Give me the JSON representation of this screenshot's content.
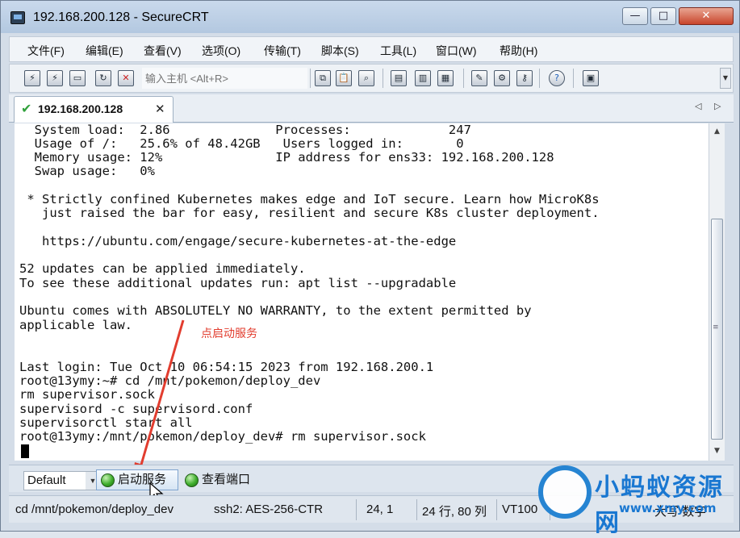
{
  "window": {
    "title": "192.168.200.128 - SecureCRT",
    "minimize": "—",
    "maximize": "□",
    "close": "✕"
  },
  "menu": [
    {
      "label": "文件(F)"
    },
    {
      "label": "编辑(E)"
    },
    {
      "label": "查看(V)"
    },
    {
      "label": "选项(O)"
    },
    {
      "label": "传输(T)"
    },
    {
      "label": "脚本(S)"
    },
    {
      "label": "工具(L)"
    },
    {
      "label": "窗口(W)"
    },
    {
      "label": "帮助(H)"
    }
  ],
  "toolbar": {
    "host_placeholder": "输入主机 <Alt+R>",
    "icons": [
      "connect-icon",
      "quick-connect-icon",
      "connect-tab-icon",
      "reconnect-icon",
      "disconnect-icon",
      "copy-icon",
      "paste-icon",
      "find-icon",
      "print-icon",
      "print-screen-icon",
      "printer-icon",
      "session-options-icon",
      "global-options-icon",
      "keymap-icon",
      "help-icon",
      "chat-icon"
    ]
  },
  "tab": {
    "label": "192.168.200.128",
    "close": "✕",
    "prev": "◁",
    "next": "▷"
  },
  "terminal": {
    "lines": [
      "  System load:  2.86              Processes:             247",
      "  Usage of /:   25.6% of 48.42GB   Users logged in:       0",
      "  Memory usage: 12%               IP address for ens33: 192.168.200.128",
      "  Swap usage:   0%",
      "",
      " * Strictly confined Kubernetes makes edge and IoT secure. Learn how MicroK8s",
      "   just raised the bar for easy, resilient and secure K8s cluster deployment.",
      "",
      "   https://ubuntu.com/engage/secure-kubernetes-at-the-edge",
      "",
      "52 updates can be applied immediately.",
      "To see these additional updates run: apt list --upgradable",
      "",
      "Ubuntu comes with ABSOLUTELY NO WARRANTY, to the extent permitted by",
      "applicable law.",
      "",
      "",
      "Last login: Tue Oct 10 06:54:15 2023 from 192.168.200.1",
      "root@13ymy:~# cd /mnt/pokemon/deploy_dev",
      "rm supervisor.sock",
      "supervisord -c supervisord.conf",
      "supervisorctl start all",
      "root@13ymy:/mnt/pokemon/deploy_dev# rm supervisor.sock"
    ]
  },
  "annotation": {
    "text": "点启动服务",
    "color": "#e23d2f"
  },
  "buttonbar": {
    "select_value": "Default",
    "buttons": [
      {
        "label": "启动服务"
      },
      {
        "label": "查看端口"
      }
    ]
  },
  "statusbar": {
    "command": "cd /mnt/pokemon/deploy_dev",
    "cipher": "ssh2: AES-256-CTR",
    "position": "24,   1",
    "size": "24 行, 80 列",
    "emulation": "VT100",
    "mode": "大写  数字"
  },
  "watermark": {
    "text": "小蚂蚁资源网",
    "url": "www.xmy.com"
  },
  "colors": {
    "accent": "#1977d1",
    "status_green": "#3fae2d",
    "annotation_red": "#e23d2f"
  }
}
